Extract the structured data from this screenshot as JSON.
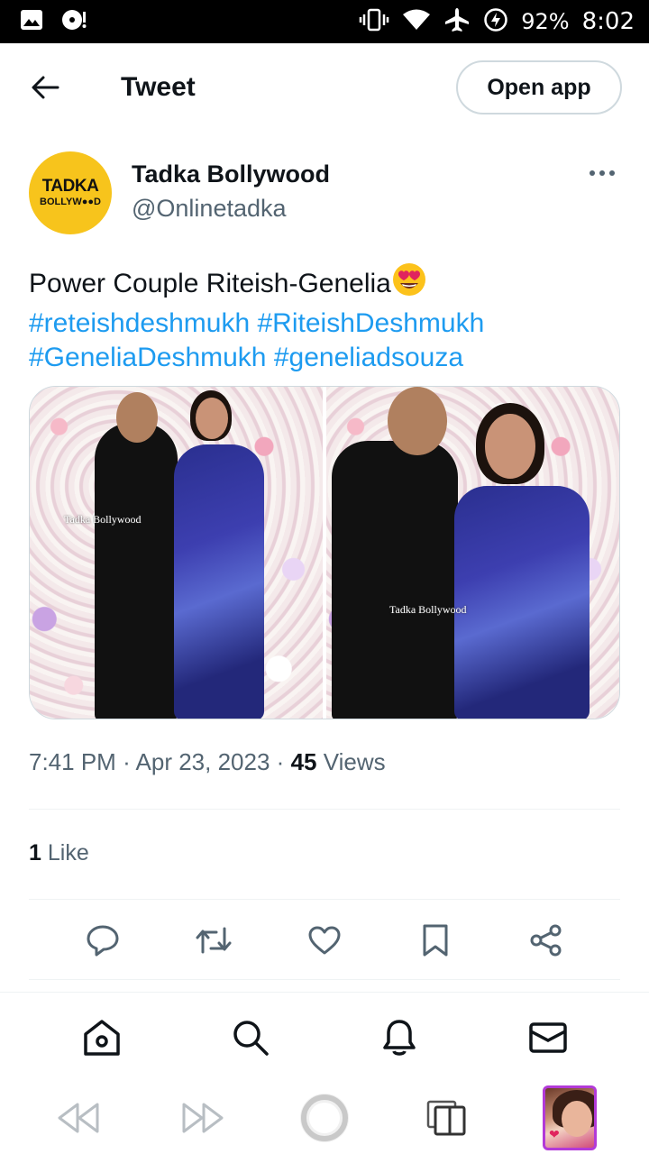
{
  "status_bar": {
    "battery": "92%",
    "time": "8:02",
    "icons": [
      "gallery-icon",
      "media-icon",
      "vibrate-icon",
      "wifi-icon",
      "airplane-icon",
      "battery-saver-icon"
    ]
  },
  "header": {
    "title": "Tweet",
    "open_app_label": "Open app"
  },
  "author": {
    "name": "Tadka Bollywood",
    "handle": "@Onlinetadka",
    "avatar_line1": "TADKA",
    "avatar_line2": "BOLLYW●●D",
    "avatar_color": "#f7c41c"
  },
  "tweet": {
    "text": "Power Couple Riteish-Genelia",
    "emoji": "😍",
    "hashtags": [
      "#reteishdeshmukh",
      "#RiteishDeshmukh",
      "#GeneliaDeshmukh",
      "#geneliadsouza"
    ],
    "hashtag_color": "#1d9bf0",
    "watermark": "Tadka Bollywood"
  },
  "meta": {
    "time": "7:41 PM",
    "date": "Apr 23, 2023",
    "views_count": "45",
    "views_label": "Views",
    "separator": "·"
  },
  "likes": {
    "count": "1",
    "label": "Like"
  },
  "actions": [
    "reply",
    "retweet",
    "like",
    "bookmark",
    "share"
  ],
  "nav": [
    "home",
    "search",
    "notifications",
    "messages"
  ]
}
